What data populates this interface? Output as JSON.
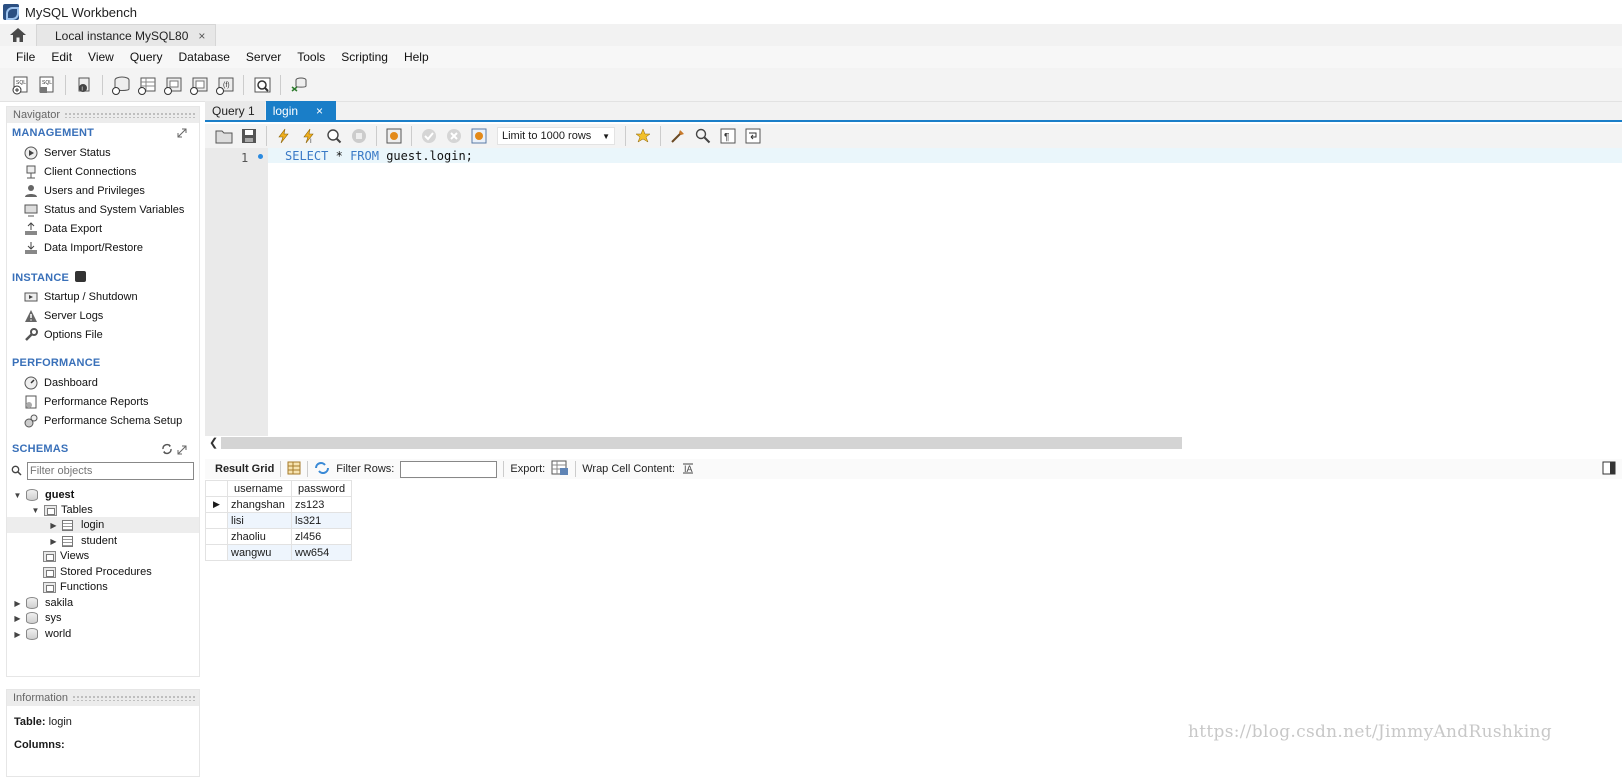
{
  "window": {
    "title": "MySQL Workbench"
  },
  "connection_tab": {
    "label": "Local instance MySQL80",
    "close": "×"
  },
  "menu": [
    "File",
    "Edit",
    "View",
    "Query",
    "Database",
    "Server",
    "Tools",
    "Scripting",
    "Help"
  ],
  "navigator": {
    "header": "Navigator",
    "management": {
      "title": "MANAGEMENT",
      "items": [
        "Server Status",
        "Client Connections",
        "Users and Privileges",
        "Status and System Variables",
        "Data Export",
        "Data Import/Restore"
      ]
    },
    "instance": {
      "title": "INSTANCE",
      "items": [
        "Startup / Shutdown",
        "Server Logs",
        "Options File"
      ]
    },
    "performance": {
      "title": "PERFORMANCE",
      "items": [
        "Dashboard",
        "Performance Reports",
        "Performance Schema Setup"
      ]
    },
    "schemas": {
      "title": "SCHEMAS",
      "filter_placeholder": "Filter objects",
      "tree": {
        "guest": "guest",
        "tables": "Tables",
        "login": "login",
        "student": "student",
        "views": "Views",
        "procedures": "Stored Procedures",
        "functions": "Functions",
        "others": [
          "sakila",
          "sys",
          "world"
        ]
      }
    }
  },
  "information": {
    "header": "Information",
    "table_label": "Table:",
    "table_name": "login",
    "columns_label": "Columns:"
  },
  "query_tabs": [
    {
      "label": "Query 1",
      "active": false
    },
    {
      "label": "login",
      "active": true,
      "close": "×"
    }
  ],
  "query_toolbar": {
    "limit": "Limit to 1000 rows"
  },
  "editor": {
    "line_number": "1",
    "tokens": [
      "SELECT",
      "*",
      "FROM",
      "guest.login;"
    ]
  },
  "results_toolbar": {
    "result_grid": "Result Grid",
    "filter_rows": "Filter Rows:",
    "filter_value": "",
    "export": "Export:",
    "wrap": "Wrap Cell Content:"
  },
  "result_grid": {
    "columns": [
      "username",
      "password"
    ],
    "rows": [
      [
        "zhangshan",
        "zs123"
      ],
      [
        "lisi",
        "ls321"
      ],
      [
        "zhaoliu",
        "zl456"
      ],
      [
        "wangwu",
        "ww654"
      ]
    ]
  },
  "watermark": "https://blog.csdn.net/JimmyAndRushking",
  "colors": {
    "accent": "#1a7ec8",
    "section": "#3970b9",
    "keyword": "#3a7ac6"
  }
}
